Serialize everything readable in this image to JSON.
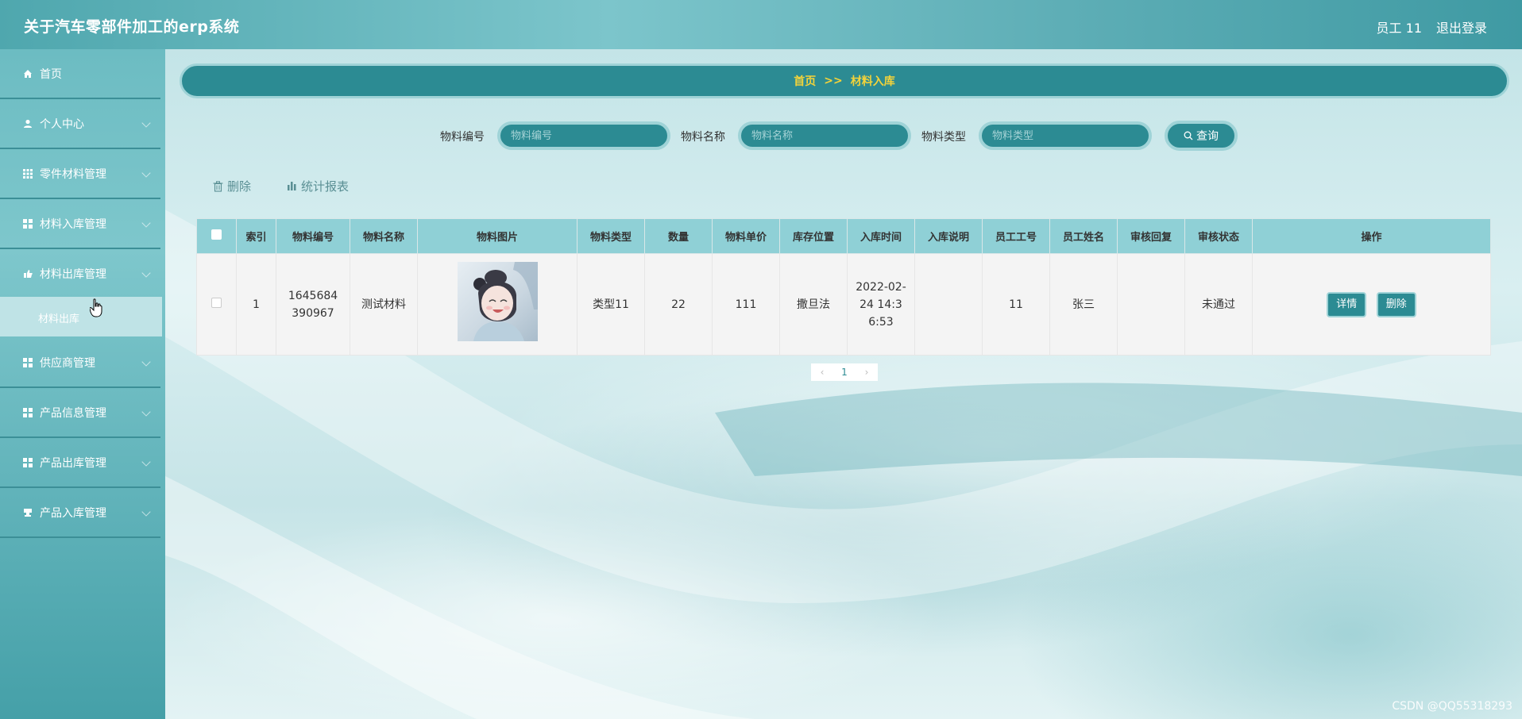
{
  "header": {
    "title": "关于汽车零部件加工的erp系统",
    "user": "员工 11",
    "logout": "退出登录"
  },
  "sidebar": {
    "items": [
      {
        "label": "首页",
        "icon": "home-icon"
      },
      {
        "label": "个人中心",
        "icon": "user-icon"
      },
      {
        "label": "零件材料管理",
        "icon": "grid-icon"
      },
      {
        "label": "材料入库管理",
        "icon": "grid-icon"
      },
      {
        "label": "材料出库管理",
        "icon": "hand-icon"
      },
      {
        "label": "供应商管理",
        "icon": "grid-icon"
      },
      {
        "label": "产品信息管理",
        "icon": "grid-icon"
      },
      {
        "label": "产品出库管理",
        "icon": "grid-icon"
      },
      {
        "label": "产品入库管理",
        "icon": "cup-icon"
      }
    ],
    "submenu_label": "材料出库"
  },
  "breadcrumb": {
    "home": "首页",
    "separator": ">>",
    "current": "材料入库"
  },
  "search": {
    "code_label": "物料编号",
    "code_placeholder": "物料编号",
    "name_label": "物料名称",
    "name_placeholder": "物料名称",
    "type_label": "物料类型",
    "type_placeholder": "物料类型",
    "button_label": "查询"
  },
  "tools": {
    "delete_label": "删除",
    "report_label": "统计报表"
  },
  "table": {
    "columns": [
      "索引",
      "物料编号",
      "物料名称",
      "物料图片",
      "物料类型",
      "数量",
      "物料单价",
      "库存位置",
      "入库时间",
      "入库说明",
      "员工工号",
      "员工姓名",
      "审核回复",
      "审核状态",
      "操作"
    ],
    "rows": [
      {
        "index": "1",
        "code": "1645684390967",
        "name": "测试材料",
        "type": "类型11",
        "quantity": "22",
        "price": "111",
        "location": "撒旦法",
        "time": "2022-02-24 14:36:53",
        "note": "",
        "emp_no": "11",
        "emp_name": "张三",
        "reply": "",
        "status": "未通过",
        "detail_label": "详情",
        "delete_label": "删除"
      }
    ]
  },
  "pagination": {
    "current": "1"
  },
  "watermark": "CSDN @QQ55318293",
  "colors": {
    "accent": "#2c8b93",
    "accent_border": "#9fd3d7",
    "breadcrumb_text": "#f3d33a",
    "table_header": "#8fd0d6"
  }
}
